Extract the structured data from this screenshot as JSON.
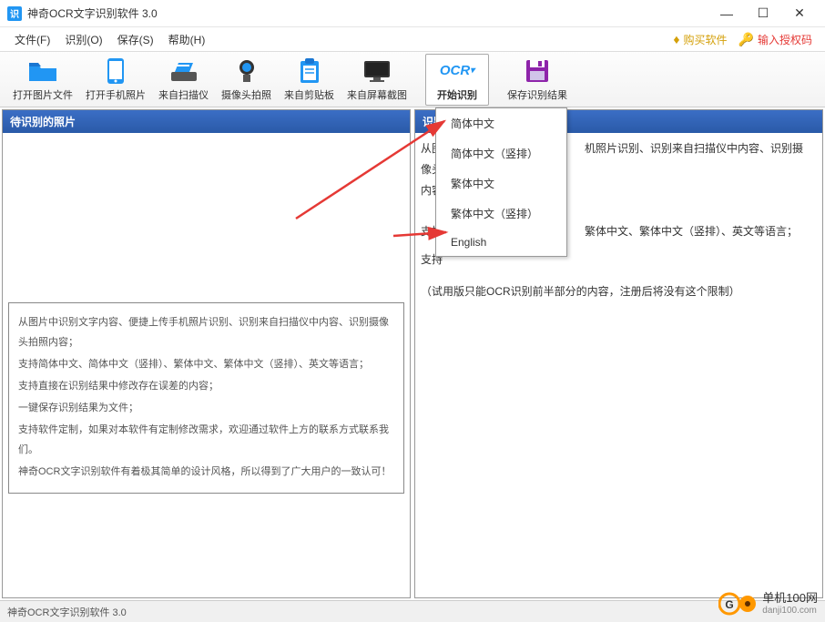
{
  "app": {
    "title": "神奇OCR文字识别软件 3.0",
    "icon_letter": "识"
  },
  "menu": {
    "file": "文件(F)",
    "recognize": "识别(O)",
    "save": "保存(S)",
    "help": "帮助(H)",
    "buy": "购买软件",
    "license": "输入授权码"
  },
  "toolbar": {
    "open_image": "打开图片文件",
    "open_phone": "打开手机照片",
    "from_scanner": "来自扫描仪",
    "from_camera": "摄像头拍照",
    "from_clipboard": "来自剪贴板",
    "from_screenshot": "来自屏幕截图",
    "ocr_label": "OCR",
    "start_recognize": "开始识别",
    "save_result": "保存识别结果"
  },
  "left_panel": {
    "title": "待识别的照片",
    "lines": [
      "从图片中识别文字内容、便捷上传手机照片识别、识别来自扫描仪中内容、识别摄像头拍照内容；",
      "支持简体中文、简体中文（竖排）、繁体中文、繁体中文（竖排）、英文等语言；",
      "支持直接在识别结果中修改存在误差的内容；",
      "一键保存识别结果为文件；",
      "支持软件定制，如果对本软件有定制修改需求，欢迎通过软件上方的联系方式联系我们。",
      "神奇OCR文字识别软件有着极其简单的设计风格，所以得到了广大用户的一致认可！"
    ]
  },
  "right_panel": {
    "title": "识别",
    "visible_lines": [
      "从图",
      "像头",
      "内容",
      "支持",
      "支持"
    ],
    "tail1": "机照片识别、识别来自扫描仪中内容、识别摄",
    "tail2": "繁体中文、繁体中文（竖排）、英文等语言；",
    "trial_note": "（试用版只能OCR识别前半部分的内容，注册后将没有这个限制）"
  },
  "dropdown": {
    "items": [
      "简体中文",
      "简体中文（竖排）",
      "繁体中文",
      "繁体中文（竖排）",
      "English"
    ]
  },
  "statusbar": {
    "text": "神奇OCR文字识别软件 3.0"
  },
  "watermark": {
    "name": "单机100网",
    "url": "danji100.com"
  }
}
